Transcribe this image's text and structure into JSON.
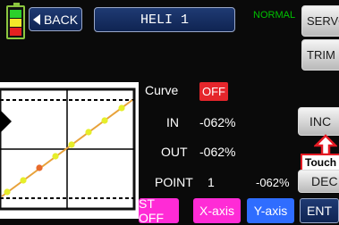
{
  "header": {
    "back_label": "BACK",
    "model_name": "HELI 1",
    "mode": "NORMAL",
    "servo_label": "SERVO",
    "trim_label": "TRIM"
  },
  "curve": {
    "curve_label": "Curve",
    "curve_state": "OFF",
    "in_label": "IN",
    "in_value": "-062%",
    "out_label": "OUT",
    "out_value": "-062%",
    "point_label": "POINT",
    "point_number": "1",
    "point_value": "-062%"
  },
  "side_buttons": {
    "inc_label": "INC",
    "dec_label": "DEC",
    "touch_label": "Touch"
  },
  "bottom_bar": {
    "st_label": "ST OFF",
    "x_axis_label": "X-axis",
    "y_axis_label": "Y-axis",
    "ent_label": "ENT"
  },
  "colors": {
    "mode_green": "#00c000",
    "off_red": "#e5262c",
    "accent_magenta": "#ff2bd6",
    "accent_blue": "#2f6dff",
    "point_yellow": "#e6ee2a",
    "point_active": "#e86b2c"
  }
}
